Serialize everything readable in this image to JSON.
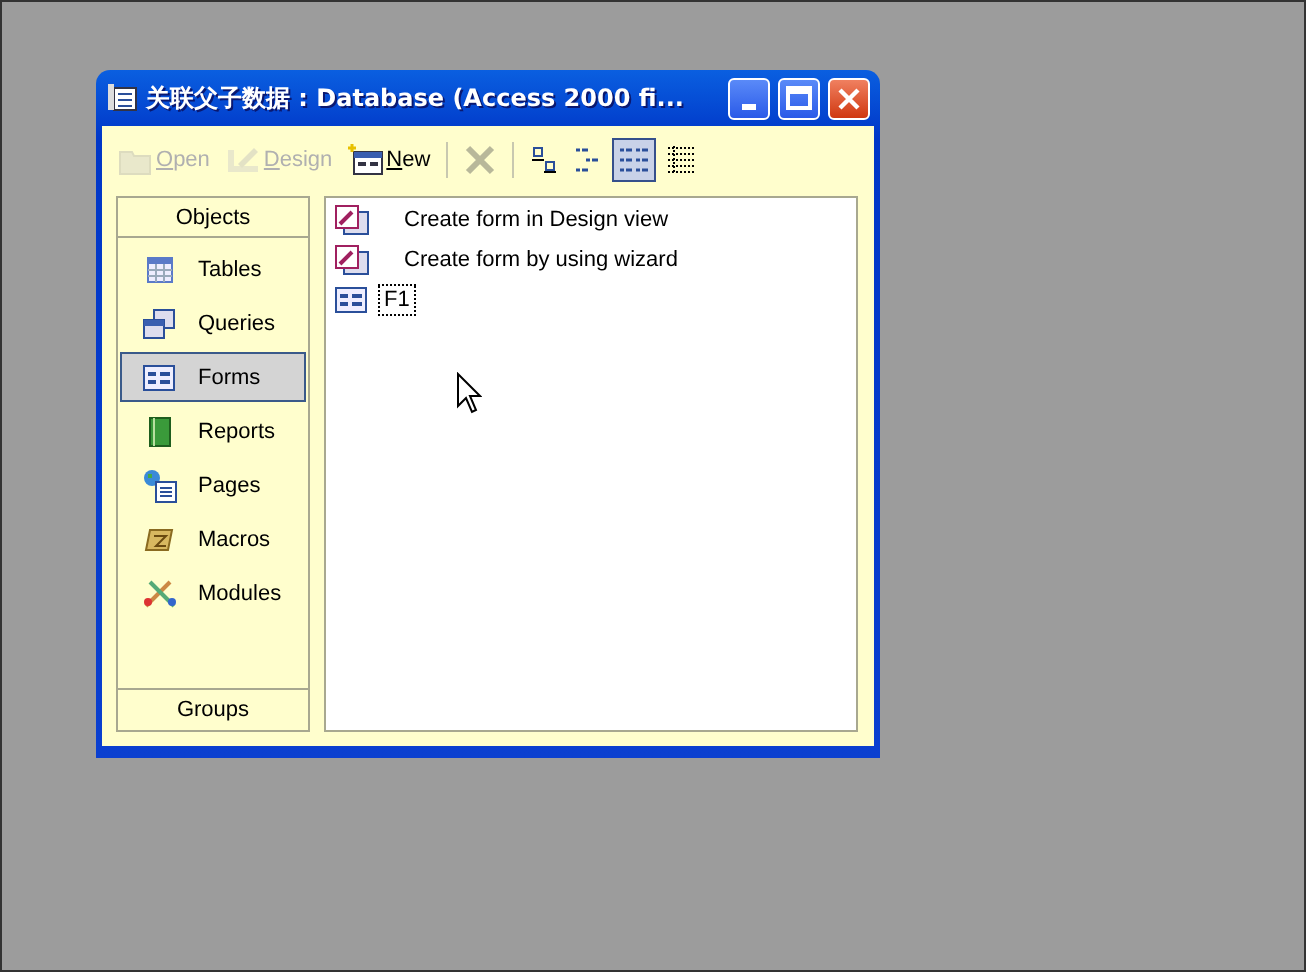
{
  "window": {
    "title": "关联父子数据 : Database (Access 2000 fi..."
  },
  "toolbar": [
    {
      "kind": "open",
      "label": "Open",
      "disabled": true
    },
    {
      "kind": "design",
      "label": "Design",
      "disabled": true
    },
    {
      "kind": "new",
      "label": "New",
      "disabled": false
    },
    {
      "kind": "delete",
      "disabled": true
    }
  ],
  "view_buttons": [
    {
      "kind": "large-icons",
      "selected": false
    },
    {
      "kind": "small-icons",
      "selected": false
    },
    {
      "kind": "list",
      "selected": true
    },
    {
      "kind": "details",
      "selected": false
    }
  ],
  "sidebar": {
    "header": "Objects",
    "items": [
      {
        "kind": "tables",
        "label": "Tables",
        "selected": false
      },
      {
        "kind": "queries",
        "label": "Queries",
        "selected": false
      },
      {
        "kind": "forms",
        "label": "Forms",
        "selected": true
      },
      {
        "kind": "reports",
        "label": "Reports",
        "selected": false
      },
      {
        "kind": "pages",
        "label": "Pages",
        "selected": false
      },
      {
        "kind": "macros",
        "label": "Macros",
        "selected": false
      },
      {
        "kind": "modules",
        "label": "Modules",
        "selected": false
      }
    ],
    "footer": "Groups"
  },
  "objects": [
    {
      "kind": "shortcut",
      "label": "Create form in Design view",
      "focused": false
    },
    {
      "kind": "shortcut",
      "label": "Create form by using wizard",
      "focused": false
    },
    {
      "kind": "form",
      "label": "F1",
      "focused": true
    }
  ]
}
